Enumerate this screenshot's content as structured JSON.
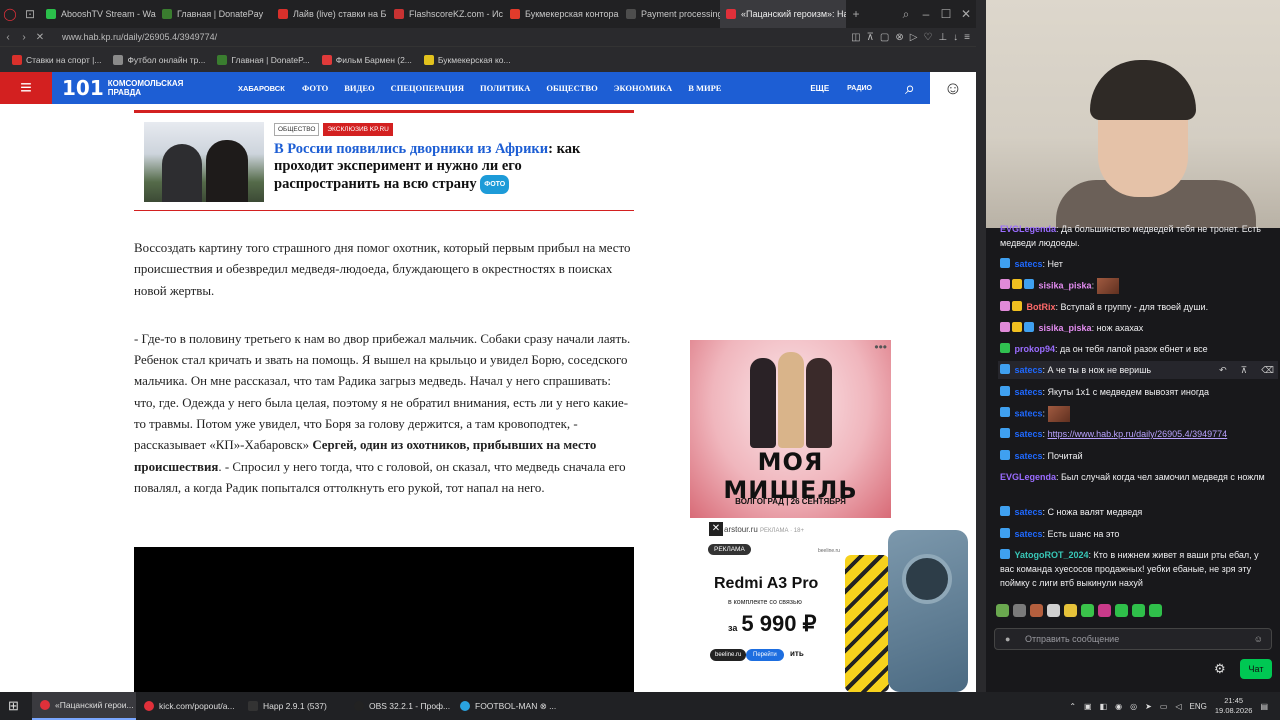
{
  "browser": {
    "tabs": [
      {
        "label": "AbooshTV Stream - Wa",
        "color": "#2bbf4b"
      },
      {
        "label": "Главная | DonatePay",
        "color": "#3a7d2f"
      },
      {
        "label": "Лайв (live) ставки на Б",
        "color": "#d9302b"
      },
      {
        "label": "FlashscoreKZ.com - Ис",
        "color": "#c83232"
      },
      {
        "label": "Букмекерская контора",
        "color": "#e23b2b"
      },
      {
        "label": "Payment processing",
        "color": "#4d4d4d"
      },
      {
        "label": "«Пацанский героизм»: На",
        "color": "#e0303a"
      }
    ],
    "new_tab": "+",
    "url": "www.hab.kp.ru/daily/26905.4/3949774/",
    "bookmarks": [
      {
        "label": "Ставки на спорт |...",
        "color": "#d9302b"
      },
      {
        "label": "Футбол онлайн тр...",
        "color": "#8a8a8a"
      },
      {
        "label": "Главная | DonateP...",
        "color": "#3a7d2f"
      },
      {
        "label": "Фильм Бармен (2...",
        "color": "#e03a3a"
      },
      {
        "label": "Букмекерская ко...",
        "color": "#e2c21d"
      }
    ]
  },
  "site": {
    "logo_num": "101",
    "logo_text1": "комсомольская",
    "logo_text2": "правда",
    "city": "ХАБАРОВСК",
    "nav": [
      "ФОТО",
      "ВИДЕО",
      "СПЕЦОПЕРАЦИЯ",
      "ПОЛИТИКА",
      "ОБЩЕСТВО",
      "ЭКОНОМИКА",
      "В МИРЕ"
    ],
    "more": "ЕЩЕ",
    "radio": "РАДИО",
    "brand_blue": "#1d5ed4",
    "brand_red": "#d32020"
  },
  "card": {
    "tag1": "ОБЩЕСТВО",
    "tag2": "ЭКСКЛЮЗИВ KP.RU",
    "title_link": "В России появились дворники из Африки",
    "title_rest": ": как проходит эксперимент и нужно ли его распространить на всю страну",
    "photo_badge": "ФОТО"
  },
  "article": {
    "p1": "Воссоздать картину того страшного дня помог охотник, который первым прибыл на место происшествия и обезвредил медведя-людоеда, блуждающего в окрестностях в поисках новой жертвы.",
    "p2a": "- Где-то в половину третьего к нам во двор прибежал мальчик. Собаки сразу начали лаять. Ребенок стал кричать и звать на помощь. Я вышел на крыльцо и увидел Борю, соседского мальчика. Он мне рассказал, что там Радика загрыз медведь. Начал у него спрашивать: что, где. Одежда у него была целая, поэтому я не обратил внимания, есть ли у него какие-то травмы. Потом уже увидел, что Боря за голову держится, а там кровоподтек, - рассказывает «КП»-Хабаровск» ",
    "p2b": "Сергей, один из охотников, прибывших на место происшествия",
    "p2c": ". - Спросил у него тогда, что с головой, он сказал, что медведь сначала его повалял, а когда Радик попытался оттолкнуть его рукой, тот напал на него."
  },
  "ads": {
    "ad1_title": "МОЯ МИШЕЛЬ",
    "ad1_sub": "ВОЛГОГРАД | 26 СЕНТЯБРЯ",
    "ad1_dots": "•••",
    "ad2_domain": "arstour.ru",
    "ad2_reklama": "РЕКЛАМА · 18+",
    "ad2_label": "РЕКЛАМА",
    "ad2_beeline": "beeline.ru",
    "ad2_title": "Redmi A3 Pro",
    "ad2_sub": "в комплекте со связью",
    "ad2_price_prefix": "за",
    "ad2_price": "5 990 ₽",
    "ad2_btn1": "beeline.ru",
    "ad2_btn2": "Перейти",
    "ad2_btn_text": "ить"
  },
  "chat": {
    "m0_user": "EVGLegenda",
    "m0_text": ": Да большинство медведей тебя не тронет. Есть медведи людоеды.",
    "m1_user": "satecs",
    "m1_text": ": Нет",
    "m2_user": "sisika_piska",
    "m2_text": ":",
    "m3_user": "BotRix",
    "m3_text": ": Вступай в группу - для твоей души.",
    "m4_user": "sisika_piska",
    "m4_text": ": нож ахахах",
    "m5_user": "prokop94",
    "m5_text": ": да он тебя лапой разок ебнет и все",
    "m6_user": "satecs",
    "m6_text": ": А че ты в нож не веришь",
    "m7_user": "satecs",
    "m7_text": ": Якуты 1х1 с медведем вывозят иногда",
    "m8_user": "satecs",
    "m8_text": ":",
    "m9_user": "satecs",
    "m9_text": ": ",
    "m9_link": "https://www.hab.kp.ru/daily/26905.4/3949774",
    "m10_user": "satecs",
    "m10_text": ": Почитай",
    "m11_user": "EVGLegenda",
    "m11_text": ": Был случай когда чел замочил медведя с ножлм",
    "m12_user": "satecs",
    "m12_text": ": С ножа валят медведя",
    "m13_user": "satecs",
    "m13_text": ": Есть шанс на это",
    "m14_user": "YatogoROT_2024",
    "m14_text": ": Кто в нижнем живет я ваши рты ебал, у вас команда хуесосов продажных! уебки ебаные, не зря эту поймку с лиги втб выкинули нахуй",
    "input_placeholder": "Отправить сообщение",
    "send_button": "Чат"
  },
  "taskbar": {
    "items": [
      {
        "label": "«Пацанский герои...",
        "color": "#e0303a"
      },
      {
        "label": "kick.com/popout/a...",
        "color": "#e0303a"
      },
      {
        "label": "Happ 2.9.1 (537)",
        "color": "#333333"
      },
      {
        "label": "OBS 32.2.1 - Проф...",
        "color": "#222222"
      },
      {
        "label": "FOOTBOL-MAN ⊗ ...",
        "color": "#2aa3e0"
      }
    ],
    "lang": "ENG",
    "time": "21:45",
    "date": "19.08.2026"
  }
}
